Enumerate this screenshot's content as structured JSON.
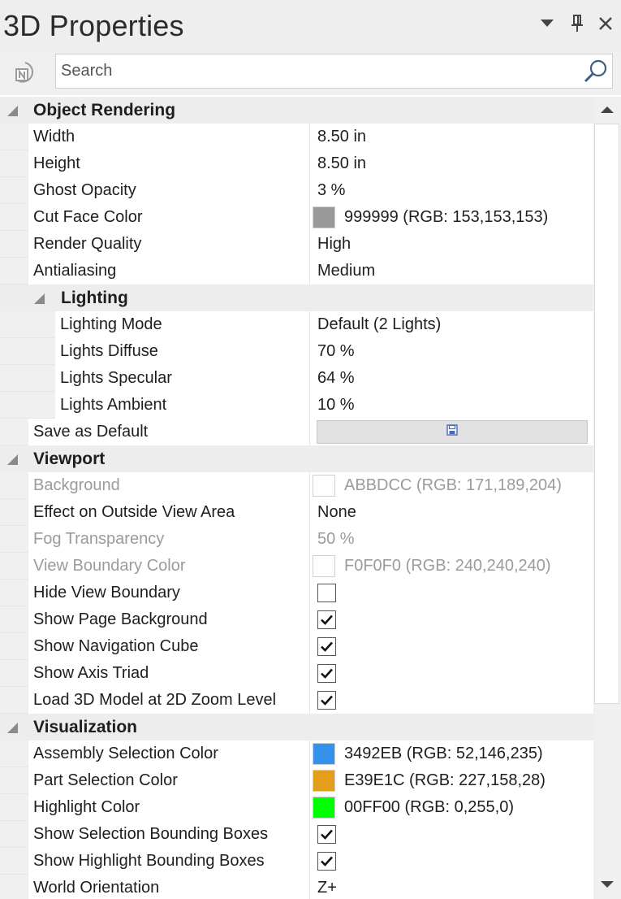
{
  "panel": {
    "title": "3D Properties"
  },
  "search": {
    "placeholder": "Search"
  },
  "icons": {
    "dropdown": "chevron-down-icon",
    "pin": "pin-icon",
    "close": "close-icon",
    "app": "app-logo-icon",
    "search": "search-icon",
    "save": "floppy-disk-icon"
  },
  "sections": {
    "object_rendering": {
      "label": "Object Rendering",
      "width": {
        "name": "Width",
        "value": "8.50 in"
      },
      "height": {
        "name": "Height",
        "value": "8.50 in"
      },
      "ghost_opacity": {
        "name": "Ghost Opacity",
        "value": "3 %"
      },
      "cut_face_color": {
        "name": "Cut Face Color",
        "value": "999999 (RGB: 153,153,153)",
        "color": "#999999"
      },
      "render_quality": {
        "name": "Render Quality",
        "value": "High"
      },
      "antialiasing": {
        "name": "Antialiasing",
        "value": "Medium"
      },
      "lighting": {
        "label": "Lighting",
        "mode": {
          "name": "Lighting Mode",
          "value": "Default (2 Lights)"
        },
        "diffuse": {
          "name": "Lights Diffuse",
          "value": "70 %"
        },
        "specular": {
          "name": "Lights Specular",
          "value": "64 %"
        },
        "ambient": {
          "name": "Lights Ambient",
          "value": "10 %"
        }
      },
      "save_default": {
        "name": "Save as Default"
      }
    },
    "viewport": {
      "label": "Viewport",
      "background": {
        "name": "Background",
        "value": "ABBDCC (RGB: 171,189,204)",
        "color": "#ffffff"
      },
      "effect_outside": {
        "name": "Effect on Outside View Area",
        "value": "None"
      },
      "fog_transparency": {
        "name": "Fog Transparency",
        "value": "50 %"
      },
      "view_boundary_color": {
        "name": "View Boundary Color",
        "value": "F0F0F0 (RGB: 240,240,240)",
        "color": "#ffffff"
      },
      "hide_view_boundary": {
        "name": "Hide View Boundary",
        "checked": false
      },
      "show_page_background": {
        "name": "Show Page Background",
        "checked": true
      },
      "show_navigation_cube": {
        "name": "Show Navigation Cube",
        "checked": true
      },
      "show_axis_triad": {
        "name": "Show Axis Triad",
        "checked": true
      },
      "load_3d_model": {
        "name": "Load 3D Model at 2D Zoom Level",
        "checked": true
      }
    },
    "visualization": {
      "label": "Visualization",
      "assembly_selection_color": {
        "name": "Assembly Selection Color",
        "value": "3492EB (RGB: 52,146,235)",
        "color": "#3492EB"
      },
      "part_selection_color": {
        "name": "Part Selection Color",
        "value": "E39E1C (RGB: 227,158,28)",
        "color": "#E39E1C"
      },
      "highlight_color": {
        "name": "Highlight Color",
        "value": "00FF00 (RGB: 0,255,0)",
        "color": "#00FF00"
      },
      "show_selection_bboxes": {
        "name": "Show Selection Bounding Boxes",
        "checked": true
      },
      "show_highlight_bboxes": {
        "name": "Show Highlight Bounding Boxes",
        "checked": true
      },
      "world_orientation": {
        "name": "World Orientation",
        "value": "Z+"
      }
    }
  }
}
